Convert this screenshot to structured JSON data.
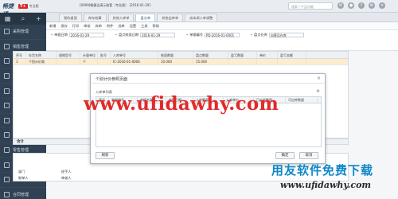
{
  "topbar": {
    "brand": "畅捷通",
    "badge": "T+",
    "edition": "专业版",
    "title": "[0099]畅捷达演示账套（专业版）    [2016-01-29]",
    "search_placeholder": "搜索 / 产品功能",
    "icons": [
      "mail-icon",
      "user-icon",
      "help-icon",
      "settings-icon",
      "close-icon"
    ]
  },
  "sidebar": {
    "tools": [
      "grid-icon",
      "search-icon",
      "add-icon"
    ],
    "items": [
      {
        "label": "采购管理"
      },
      {
        "label": "销售管理"
      },
      {
        "label": "订货商城"
      },
      {
        "label": "电商通"
      },
      {
        "label": "往来现金"
      },
      {
        "label": "库存管理"
      },
      {
        "label": "存货核算"
      },
      {
        "label": "配送管理"
      },
      {
        "label": "零售管理"
      },
      {
        "label": "促销管理"
      },
      {
        "label": "会员管理"
      },
      {
        "label": "合同管理"
      }
    ]
  },
  "tabs": [
    {
      "label": "我的桌面",
      "active": false
    },
    {
      "label": "库存结算",
      "active": false
    },
    {
      "label": "其他入库单",
      "active": false
    },
    {
      "label": "盘点单",
      "active": true
    },
    {
      "label": "其他出库单",
      "active": false
    },
    {
      "label": "成本调入单调整",
      "active": false
    }
  ],
  "toolbar": [
    "新增",
    "保存",
    "打印",
    "审核",
    "弃审",
    "附件",
    "选单",
    "设置",
    "工具",
    "帮助"
  ],
  "form": {
    "row1": [
      {
        "label": "单据日期",
        "value": "2016-01-29"
      },
      {
        "label": "盘点账面日期",
        "value": "2016-01-29"
      },
      {
        "label": "单据编号",
        "value": "PD-2016-01-0001"
      },
      {
        "label": "盘点仓库",
        "value": "自营品仓库"
      }
    ]
  },
  "grid": {
    "headers": [
      "序号",
      "存货名称",
      "规格型号",
      "计量单位",
      "批号",
      "入库单号",
      "账面数量",
      "盘点数量",
      "盈亏数量",
      "单价",
      "盈亏金额"
    ],
    "row": [
      "1",
      "个别计价商",
      "",
      "个",
      "",
      "IC-2016-01-0006",
      "10.000",
      "15.000",
      "",
      "",
      ""
    ],
    "sum_label": "合计"
  },
  "footer": {
    "fields": [
      "部门",
      "经手人",
      "制单人",
      "审核人"
    ],
    "note": "提示：默认批号、批次、有效期、批号时间"
  },
  "modal": {
    "title": "个别计价参照页面",
    "subtitle": "入库单列表",
    "headers": [
      "序号",
      "单据编号",
      "单据名称",
      "单据日期",
      "入库数量",
      "入库单价",
      "已出库数量",
      "可出库数量"
    ],
    "btn_refresh": "刷新",
    "btn_ok": "确定",
    "btn_cancel": "取消"
  },
  "watermark": {
    "url": "www.ufidawhy.com",
    "logo_text": "用友软件免费下载",
    "logo_url": "www.ufidawhy.com"
  }
}
